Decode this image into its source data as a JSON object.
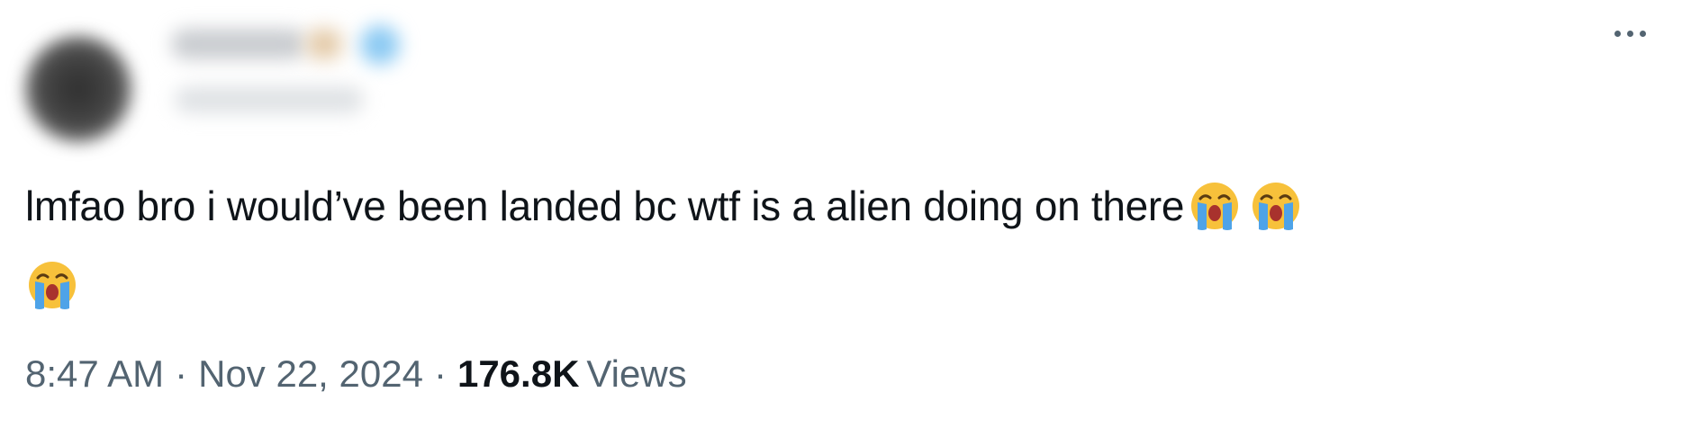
{
  "tweet": {
    "text": "lmfao bro i would’ve been landed bc wtf is a alien doing on there",
    "emojis": [
      "loudly-crying-face-emoji",
      "loudly-crying-face-emoji",
      "loudly-crying-face-emoji"
    ],
    "time": "8:47 AM",
    "separator": "·",
    "date": "Nov 22, 2024",
    "views_count": "176.8K",
    "views_label": "Views"
  },
  "icons": {
    "more": "more-options-icon",
    "verified": "verified-badge-icon"
  },
  "colors": {
    "text_primary": "#0f1419",
    "text_secondary": "#536471",
    "emoji_face": "#f7c13b",
    "emoji_tears": "#4ea3e8",
    "emoji_mouth": "#a8322d"
  }
}
